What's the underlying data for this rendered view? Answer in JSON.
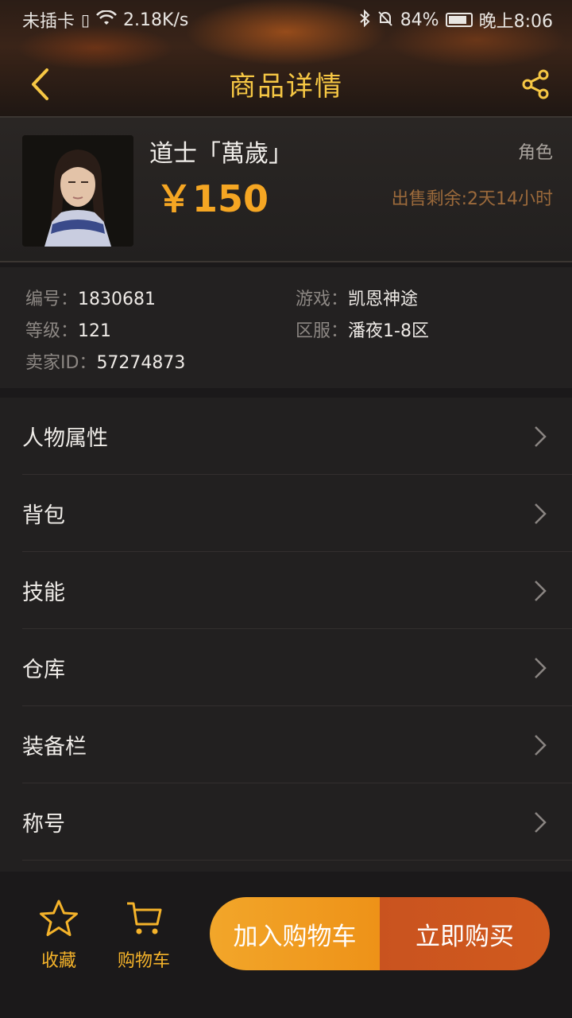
{
  "status_bar": {
    "carrier": "未插卡",
    "speed": "2.18K/s",
    "battery": "84%",
    "time": "晚上8:06"
  },
  "nav": {
    "title": "商品详情"
  },
  "product": {
    "name": "道士「萬歲」",
    "type": "角色",
    "price": "￥150",
    "remaining": "出售剩余:2天14小时"
  },
  "info": {
    "id_key": "编号：",
    "id_val": "1830681",
    "game_key": "游戏：",
    "game_val": "凯恩神途",
    "level_key": "等级：",
    "level_val": "121",
    "server_key": "区服：",
    "server_val": "潘夜1-8区",
    "seller_key": "卖家ID：",
    "seller_val": "57274873"
  },
  "menu": {
    "items": [
      {
        "label": "人物属性"
      },
      {
        "label": "背包"
      },
      {
        "label": "技能"
      },
      {
        "label": "仓库"
      },
      {
        "label": "装备栏"
      },
      {
        "label": "称号"
      }
    ]
  },
  "bottom": {
    "favorite": "收藏",
    "cart": "购物车",
    "add_cart": "加入购物车",
    "buy_now": "立即购买"
  },
  "colors": {
    "accent": "#f6c744",
    "price": "#f5a623",
    "cart_button": "#ee9218",
    "buy_button": "#c9531f"
  }
}
